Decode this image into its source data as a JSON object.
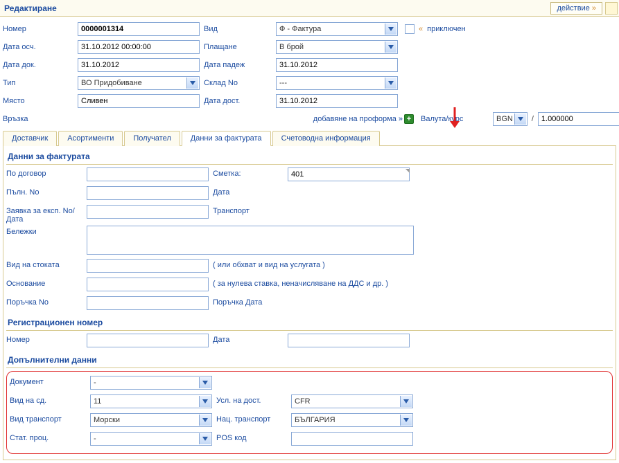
{
  "page": {
    "title": "Редактиране",
    "action_button": "действие",
    "action_arrows": "»"
  },
  "header": {
    "labels": {
      "number": "Номер",
      "date_posting": "Дата осч.",
      "date_doc": "Дата док.",
      "type": "Тип",
      "place": "Място",
      "link": "Връзка",
      "kind": "Вид",
      "payment": "Плащане",
      "due_date": "Дата падеж",
      "warehouse": "Склад No",
      "delivery_date": "Дата дост.",
      "currency": "Валута/курс",
      "attached_marker": "«",
      "attached": "приключен",
      "proforma_link": "добавяне на проформа »"
    },
    "values": {
      "number": "0000001314",
      "date_posting": "31.10.2012 00:00:00",
      "date_doc": "31.10.2012",
      "type": "ВО Придобиване",
      "place": "Сливен",
      "kind": "Ф - Фактура",
      "payment": "В брой",
      "due_date": "31.10.2012",
      "warehouse": "---",
      "delivery_date": "31.10.2012",
      "currency": "BGN",
      "rate_sep": "/",
      "rate": "1.000000"
    }
  },
  "tabs": {
    "supplier": "Доставчик",
    "assortments": "Асортименти",
    "recipient": "Получател",
    "invoice_data": "Данни за фактурата",
    "accounting_info": "Счетоводна информация"
  },
  "invoice_data": {
    "section_title": "Данни за фактурата",
    "labels": {
      "contract": "По договор",
      "full_no": "Пълн. No",
      "export_req": "Заявка за експ. No/Дата",
      "notes": "Бележки",
      "goods_type": "Вид на стоката",
      "basis": "Основание",
      "order_no": "Поръчка No",
      "account": "Сметка:",
      "date": "Дата",
      "transport": "Транспорт",
      "order_date": "Поръчка Дата",
      "hint_goods": "( или обхват и вид на услугата )",
      "hint_basis": "( за нулева ставка, неначисляване на ДДС и др. )"
    },
    "values": {
      "contract": "",
      "full_no": "",
      "export_req": "",
      "notes": "",
      "goods_type": "",
      "basis": "",
      "order_no": "",
      "account": "401",
      "date": "",
      "transport": "",
      "order_date": ""
    }
  },
  "registration": {
    "section_title": "Регистрационен номер",
    "labels": {
      "number": "Номер",
      "date": "Дата"
    },
    "values": {
      "number": "",
      "date": ""
    }
  },
  "additional": {
    "section_title": "Допълнителни данни",
    "labels": {
      "document": "Документ",
      "deal_type": "Вид на сд.",
      "transport_type": "Вид транспорт",
      "stat_proc": "Стат. проц.",
      "delivery_terms": "Усл. на дост.",
      "national_transport": "Нац. транспорт",
      "pos_code": "POS код"
    },
    "values": {
      "document": "-",
      "deal_type": "11",
      "transport_type": "Морски",
      "stat_proc": "-",
      "delivery_terms": "CFR",
      "national_transport": "БЪЛГАРИЯ",
      "pos_code": ""
    }
  }
}
